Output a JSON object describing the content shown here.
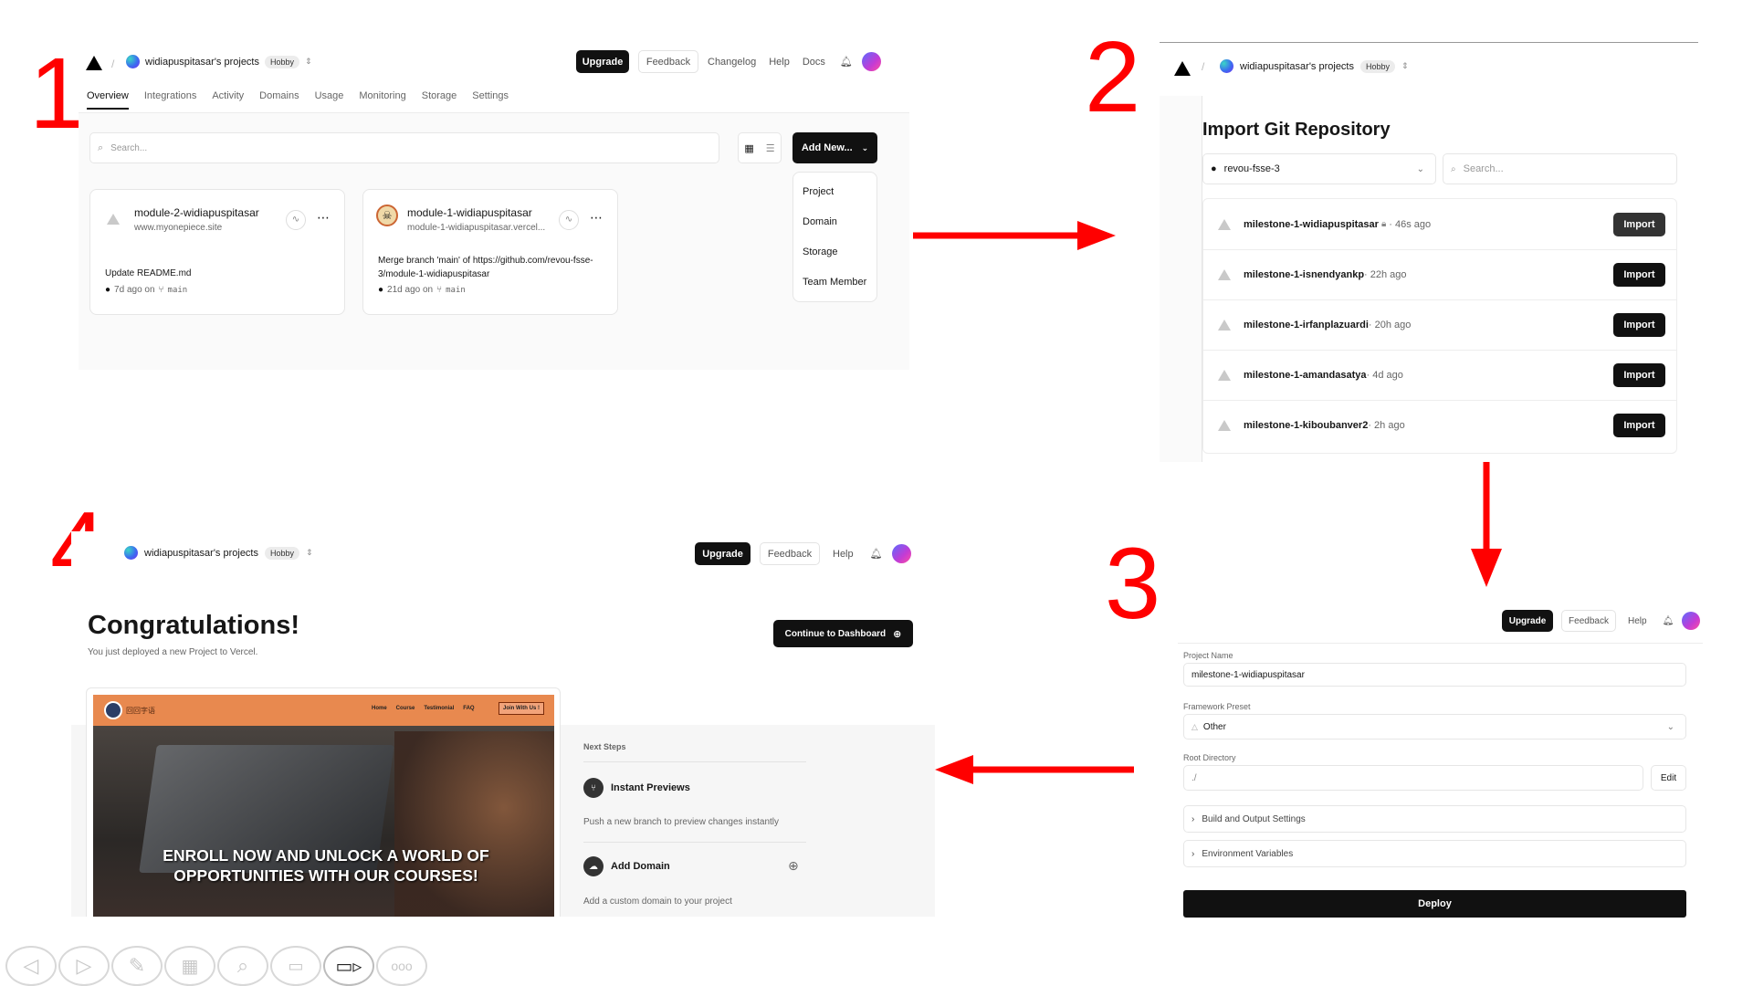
{
  "step_numbers": [
    "1",
    "2",
    "3",
    "4"
  ],
  "panel1": {
    "project_scope": "widiapuspitasar's projects",
    "plan_badge": "Hobby",
    "header_buttons": {
      "upgrade": "Upgrade",
      "feedback": "Feedback",
      "changelog": "Changelog",
      "help": "Help",
      "docs": "Docs"
    },
    "tabs": [
      "Overview",
      "Integrations",
      "Activity",
      "Domains",
      "Usage",
      "Monitoring",
      "Storage",
      "Settings"
    ],
    "search_placeholder": "Search...",
    "add_new_label": "Add New...",
    "add_new_menu": [
      "Project",
      "Domain",
      "Storage",
      "Team Member"
    ],
    "cards": [
      {
        "name": "module-2-widiapuspitasar",
        "url": "www.myonepiece.site",
        "commit": "Update README.md",
        "meta_time": "7d ago on",
        "branch": "main"
      },
      {
        "name": "module-1-widiapuspitasar",
        "url": "module-1-widiapuspitasar.vercel...",
        "commit": "Merge branch 'main' of https://github.com/revou-fsse-3/module-1-widiapuspitasar",
        "meta_time": "21d ago on",
        "branch": "main"
      }
    ]
  },
  "panel2": {
    "project_scope": "widiapuspitasar's projects",
    "plan_badge": "Hobby",
    "title": "Import Git Repository",
    "org_select": "revou-fsse-3",
    "search_placeholder": "Search...",
    "import_label": "Import",
    "repos": [
      {
        "name": "milestone-1-widiapuspitasar",
        "private": true,
        "time": " · 46s ago"
      },
      {
        "name": "milestone-1-isnendyankp",
        "private": false,
        "time": " · 22h ago"
      },
      {
        "name": "milestone-1-irfanplazuardi",
        "private": false,
        "time": " · 20h ago"
      },
      {
        "name": "milestone-1-amandasatya",
        "private": false,
        "time": " · 4d ago"
      },
      {
        "name": "milestone-1-kiboubanver2",
        "private": false,
        "time": " · 2h ago"
      }
    ]
  },
  "panel3": {
    "header_buttons": {
      "upgrade": "Upgrade",
      "feedback": "Feedback",
      "help": "Help"
    },
    "project_name_label": "Project Name",
    "project_name_value": "milestone-1-widiapuspitasar",
    "framework_label": "Framework Preset",
    "framework_value": "Other",
    "root_label": "Root Directory",
    "root_value": "./",
    "edit_label": "Edit",
    "build_settings": "Build and Output Settings",
    "env_vars": "Environment Variables",
    "deploy_label": "Deploy"
  },
  "panel4": {
    "project_scope": "widiapuspitasar's projects",
    "plan_badge": "Hobby",
    "header_buttons": {
      "upgrade": "Upgrade",
      "feedback": "Feedback",
      "help": "Help"
    },
    "title": "Congratulations!",
    "subtitle": "You just deployed a new Project to Vercel.",
    "continue_label": "Continue to Dashboard",
    "preview_nav": [
      "Home",
      "Course",
      "Testimonial",
      "FAQ"
    ],
    "preview_join": "Join With Us !",
    "preview_logo_text": "回回字语",
    "preview_headline": "ENROLL NOW AND UNLOCK A WORLD OF OPPORTUNITIES WITH OUR COURSES!",
    "next_steps_label": "Next Steps",
    "steps": [
      {
        "title": "Instant Previews",
        "desc": "Push a new branch to preview changes instantly"
      },
      {
        "title": "Add Domain",
        "desc": "Add a custom domain to your project"
      }
    ]
  },
  "slideshow_controls": [
    "previous-slide-icon",
    "next-slide-icon",
    "pen-icon",
    "slides-grid-icon",
    "zoom-icon",
    "subtitles-icon",
    "camera-icon",
    "more-options-icon"
  ],
  "colors": {
    "accent_red": "#ff0000",
    "black_button": "#111111",
    "preview_orange": "#e8894f"
  }
}
